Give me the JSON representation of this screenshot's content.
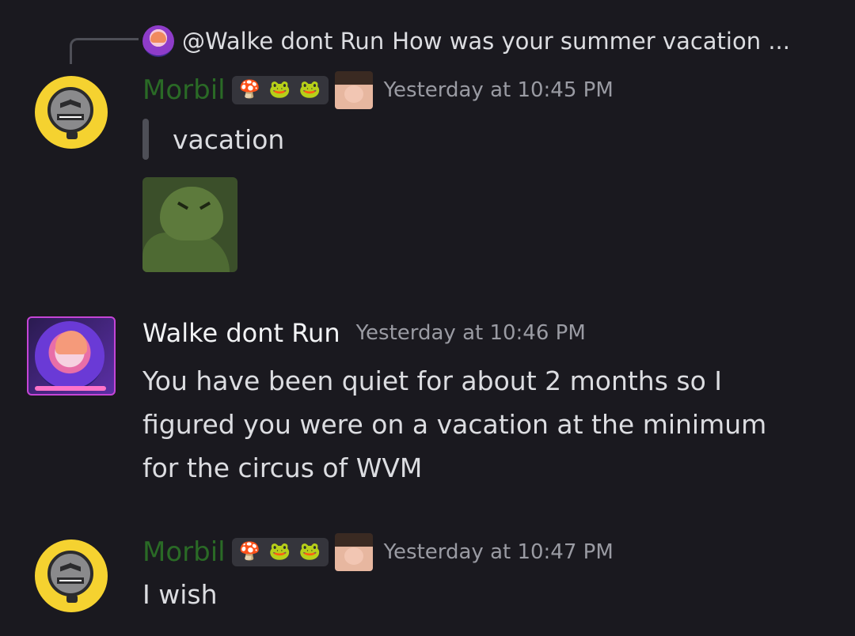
{
  "reply": {
    "author": "@Walke dont Run",
    "text": "How was your summer vacation ..."
  },
  "messages": [
    {
      "author": "Morbil",
      "author_color": "#2a6a26",
      "badges": [
        "mushroom-icon",
        "frog-icon",
        "frog-icon"
      ],
      "timestamp": "Yesterday at 10:45 PM",
      "quote": "vacation",
      "sticker": "frog-sticker"
    },
    {
      "author": "Walke dont Run",
      "timestamp": "Yesterday at 10:46 PM",
      "lines": [
        "You have been quiet for about 2 months so I",
        "figured you were on a vacation at the minimum",
        "for the circus of WVM"
      ]
    },
    {
      "author": "Morbil",
      "author_color": "#2a6a26",
      "badges": [
        "mushroom-icon",
        "frog-icon",
        "frog-icon"
      ],
      "timestamp": "Yesterday at 10:47 PM",
      "text": "I wish"
    }
  ],
  "badge_glyphs": {
    "mushroom": "🍄",
    "frog": "🐸"
  }
}
